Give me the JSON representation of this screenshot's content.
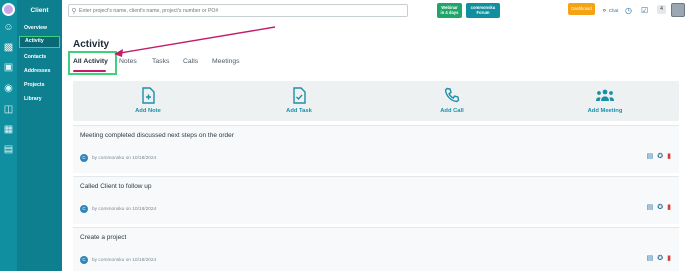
{
  "sidebar": {
    "title": "Client",
    "items": [
      "Overview",
      "Activity",
      "Contacts",
      "Addresses",
      "Projects",
      "Library"
    ]
  },
  "topbar": {
    "search_placeholder": "Enter project's name, client's name, project's number or PO#",
    "webinar_line1": "Webinar",
    "webinar_line2": "in 4 days",
    "forum_line1": "commonsku",
    "forum_line2": "Forum",
    "dashboard": "Dashboard",
    "chat": "Chat",
    "badge": "4"
  },
  "page": {
    "title": "Activity",
    "tabs": [
      "All Activity",
      "Notes",
      "Tasks",
      "Calls",
      "Meetings"
    ]
  },
  "actions": [
    {
      "label": "Add Note",
      "icon": "note-add-icon"
    },
    {
      "label": "Add Task",
      "icon": "task-add-icon"
    },
    {
      "label": "Add Call",
      "icon": "phone-icon"
    },
    {
      "label": "Add Meeting",
      "icon": "group-icon"
    }
  ],
  "entries": [
    {
      "text": "Meeting completed discussed next steps on the order",
      "avatar": "C",
      "by": "by commonsku on 10/18/2024"
    },
    {
      "text": "Called Client to follow up",
      "avatar": "C",
      "by": "by commonsku on 10/18/2024"
    },
    {
      "text": "Create a project",
      "avatar": "C",
      "by": "by commonsku on 10/18/2024"
    }
  ],
  "colors": {
    "rail": "#0f8fa0",
    "sidebar": "#0d7f8f",
    "accent": "#1b8fa8",
    "highlight_box": "#3fd07a",
    "annotation_arrow": "#c31d6a",
    "dashboard": "#f5a315",
    "webinar": "#1fa56a"
  }
}
